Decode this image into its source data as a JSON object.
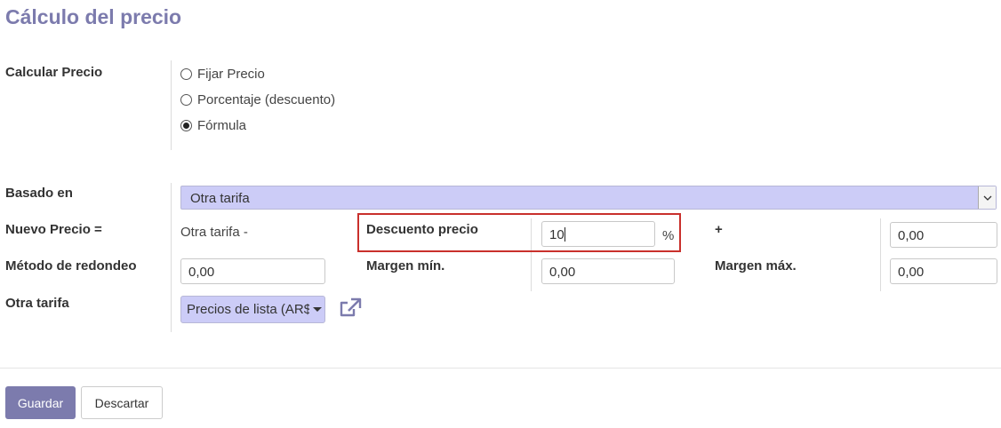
{
  "page_title": "Cálculo del precio",
  "compute_price": {
    "label": "Calcular Precio",
    "options": [
      "Fijar Precio",
      "Porcentaje (descuento)",
      "Fórmula"
    ],
    "selected": "Fórmula"
  },
  "based_on": {
    "label": "Basado en",
    "value": "Otra tarifa"
  },
  "new_price": {
    "label": "Nuevo Precio =",
    "text": "Otra tarifa -",
    "discount_label": "Descuento precio",
    "discount_value": "10",
    "percent_symbol": "%",
    "plus_symbol": "+",
    "surcharge_value": "0,00"
  },
  "rounding": {
    "label": "Método de redondeo",
    "value": "0,00",
    "min_margin_label": "Margen mín.",
    "min_margin_value": "0,00",
    "max_margin_label": "Margen máx.",
    "max_margin_value": "0,00"
  },
  "other_pricelist": {
    "label": "Otra tarifa",
    "value": "Precios de lista (AR$)"
  },
  "buttons": {
    "save": "Guardar",
    "discard": "Descartar"
  },
  "colors": {
    "brand": "#7c7bad",
    "select_bg": "#ccccf7",
    "highlight": "#c9302c"
  }
}
